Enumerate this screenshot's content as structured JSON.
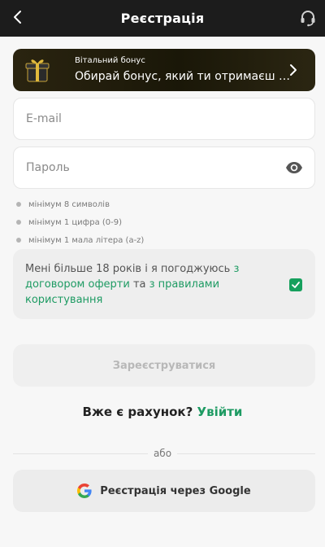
{
  "header": {
    "title": "Реєстрація",
    "back_icon": "chevron-left-icon",
    "support_icon": "headset-icon"
  },
  "bonus": {
    "small_label": "Вітальний бонус",
    "text": "Обирай бонус, який ти отримаєш після реєстрації",
    "icon": "gift-icon"
  },
  "form": {
    "email_placeholder": "E-mail",
    "password_placeholder": "Пароль",
    "email_value": "",
    "password_value": ""
  },
  "password_rules": [
    "мінімум 8 символів",
    "мінімум 1 цифра (0-9)",
    "мінімум 1 мала літера (a-z)"
  ],
  "agreement": {
    "prefix": "Мені більше 18 років і я погоджуюсь ",
    "link1": "з договором оферти",
    "middle": " та ",
    "link2": "з правилами користування",
    "checked": true
  },
  "register_button": "Зареєструватися",
  "login": {
    "question": "Вже є рахунок? ",
    "link": "Увійти"
  },
  "divider_text": "або",
  "google_button": "Реєстрація через Google",
  "colors": {
    "accent": "#1e9b63",
    "header_bg": "#1c1c1c",
    "page_bg": "#f7f7f7"
  }
}
